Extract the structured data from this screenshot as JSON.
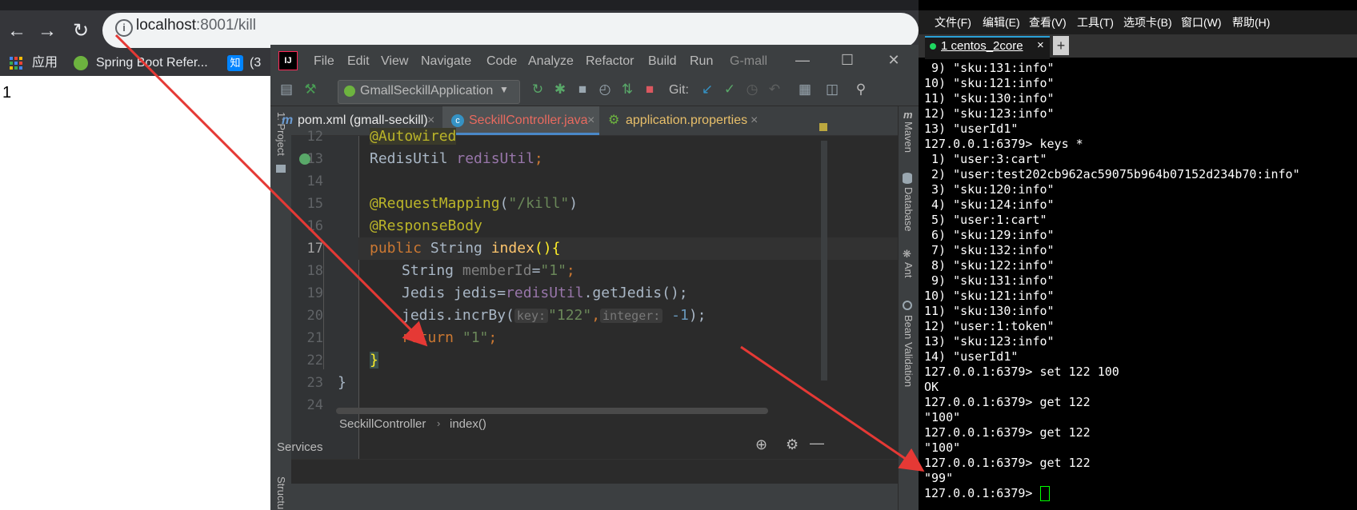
{
  "browser": {
    "url_host": "localhost",
    "url_path": ":8001/kill",
    "bookmarks": [
      {
        "label": "应用"
      },
      {
        "label": "Spring Boot Refer..."
      },
      {
        "label": "(3 "
      }
    ],
    "bookmark_zhihu_icon": "知",
    "page_content": "1"
  },
  "ide": {
    "logo": "IJ",
    "menu": [
      "File",
      "Edit",
      "View",
      "Navigate",
      "Code",
      "Analyze",
      "Refactor",
      "Build",
      "Run",
      "G-mall"
    ],
    "run_config": "GmallSeckillApplication",
    "git_label": "Git:",
    "tabs": [
      {
        "label": "pom.xml (gmall-seckill)",
        "icon": "m"
      },
      {
        "label": "SeckillController.java",
        "icon": "c"
      },
      {
        "label": "application.properties",
        "icon": "gear"
      }
    ],
    "left_strip": {
      "project": "1: Project",
      "structure": "Structure"
    },
    "right_strip": [
      "Maven",
      "Database",
      "Ant",
      "Bean Validation"
    ],
    "line_numbers": [
      "12",
      "13",
      "14",
      "15",
      "16",
      "17",
      "18",
      "19",
      "20",
      "21",
      "22",
      "23",
      "24"
    ],
    "code": {
      "l12": "@Autowired",
      "l13_type": "RedisUtil ",
      "l13_field": "redisUtil",
      "l13_end": ";",
      "l15_ann": "@RequestMapping",
      "l15_open": "(",
      "l15_str": "\"/kill\"",
      "l15_close": ")",
      "l16": "@ResponseBody",
      "l17_kw": "public ",
      "l17_type": "String ",
      "l17_name": "index",
      "l17_paren": "(){",
      "l18_type": "String ",
      "l18_var": "memberId",
      "l18_eq": "=",
      "l18_str": "\"1\"",
      "l18_end": ";",
      "l19_a": "Jedis jedis=",
      "l19_field": "redisUtil",
      "l19_b": ".getJedis();",
      "l20_a": "jedis.incrBy(",
      "l20_hint1": "key:",
      "l20_str": "\"122\"",
      "l20_comma": ",",
      "l20_hint2": "integer:",
      "l20_num": " -1",
      "l20_end": ");",
      "l21_kw": "return ",
      "l21_str": "\"1\"",
      "l21_end": ";",
      "l22": "}",
      "l23": "}"
    },
    "breadcrumb": [
      "SeckillController",
      "index()"
    ],
    "services_label": "Services"
  },
  "terminal": {
    "menu": [
      "文件(F)",
      "编辑(E)",
      "查看(V)",
      "工具(T)",
      "选项卡(B)",
      "窗口(W)",
      "帮助(H)"
    ],
    "tab_label": "1 centos_2core",
    "lines": [
      " 9) \"sku:131:info\"",
      "10) \"sku:121:info\"",
      "11) \"sku:130:info\"",
      "12) \"sku:123:info\"",
      "13) \"userId1\"",
      "127.0.0.1:6379> keys *",
      " 1) \"user:3:cart\"",
      " 2) \"user:test202cb962ac59075b964b07152d234b70:info\"",
      " 3) \"sku:120:info\"",
      " 4) \"sku:124:info\"",
      " 5) \"user:1:cart\"",
      " 6) \"sku:129:info\"",
      " 7) \"sku:132:info\"",
      " 8) \"sku:122:info\"",
      " 9) \"sku:131:info\"",
      "10) \"sku:121:info\"",
      "11) \"sku:130:info\"",
      "12) \"user:1:token\"",
      "13) \"sku:123:info\"",
      "14) \"userId1\"",
      "127.0.0.1:6379> set 122 100",
      "OK",
      "127.0.0.1:6379> get 122",
      "\"100\"",
      "127.0.0.1:6379> get 122",
      "\"100\"",
      "127.0.0.1:6379> get 122",
      "\"99\""
    ],
    "prompt": "127.0.0.1:6379> "
  },
  "colors": {
    "arrow": "#e53935",
    "terminal_bg": "#000000",
    "editor_bg": "#2b2b2b",
    "keyword": "#cc7832",
    "annotation": "#bbb529",
    "string": "#6a8759"
  }
}
